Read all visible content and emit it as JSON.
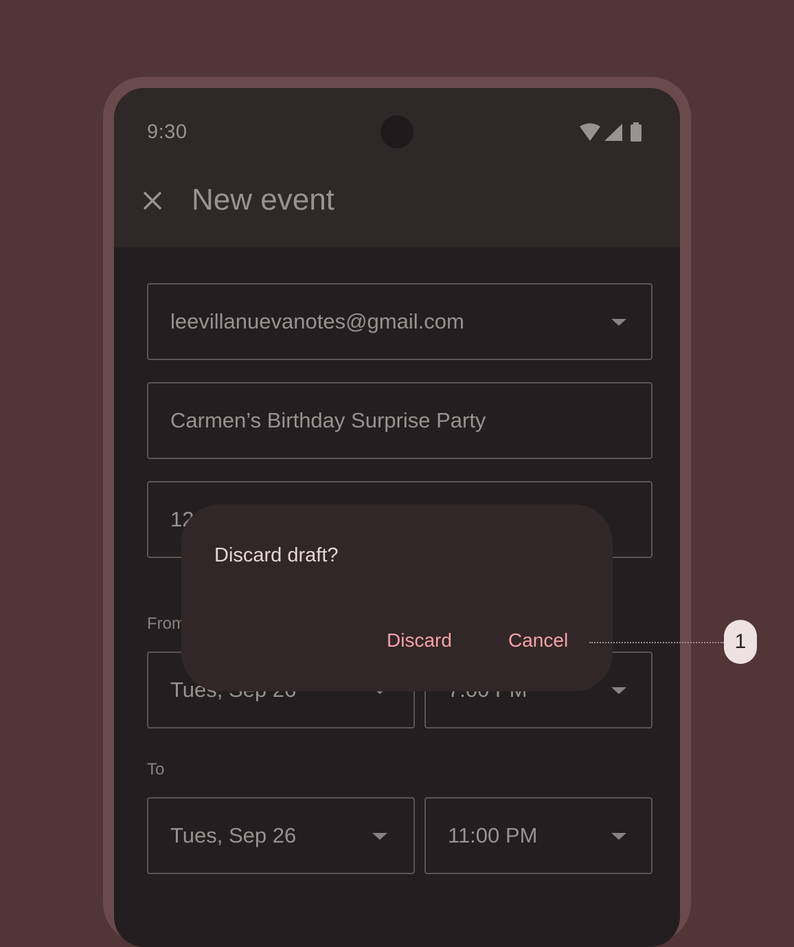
{
  "status_bar": {
    "time": "9:30",
    "icons": [
      "wifi-icon",
      "signal-icon",
      "battery-icon"
    ]
  },
  "app_bar": {
    "close_icon": "close-icon",
    "title": "New event"
  },
  "form": {
    "account": "leevillanuevanotes@gmail.com",
    "event_title": "Carmen’s Birthday Surprise Party",
    "third_field_partial": "12",
    "from_label": "From",
    "from_date_partial": "Tues, Sep 26",
    "from_time_partial": "7:00 PM",
    "to_label": "To",
    "to_date": "Tues, Sep 26",
    "to_time": "11:00 PM"
  },
  "dialog": {
    "title": "Discard draft?",
    "discard_label": "Discard",
    "cancel_label": "Cancel"
  },
  "callout": {
    "number": "1"
  },
  "colors": {
    "background": "#523537",
    "phone_frame": "#6a4a4c",
    "screen": "#231e1f",
    "top_bar": "#2f2828",
    "dialog": "#322728",
    "dialog_button": "#f6a2a6",
    "callout_badge": "#ede2e1"
  }
}
